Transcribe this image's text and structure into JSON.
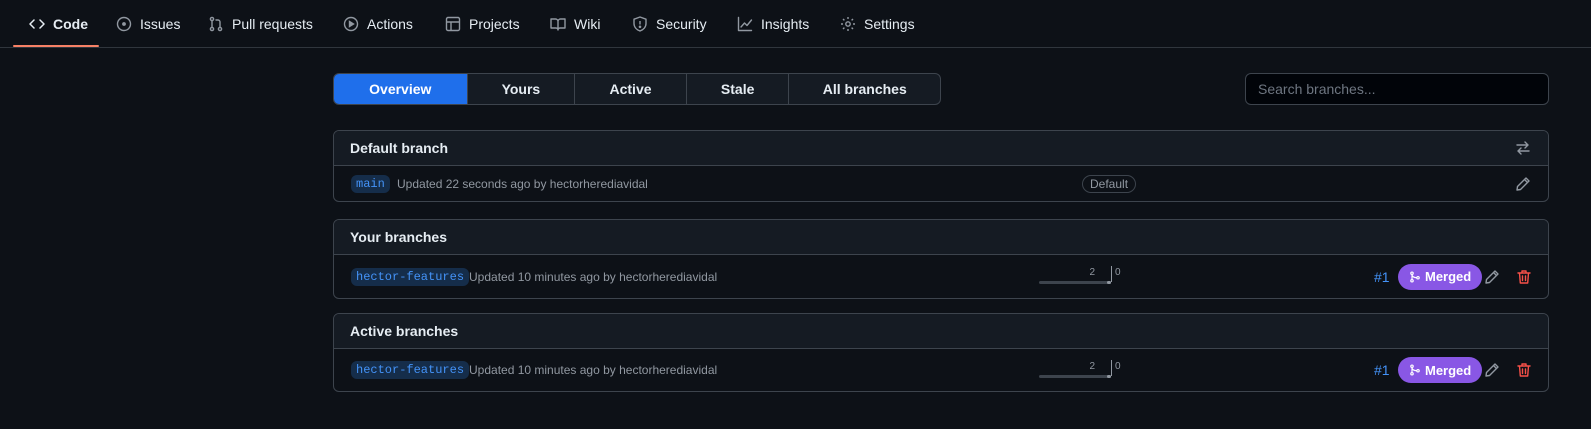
{
  "nav": {
    "items": [
      {
        "label": "Code",
        "icon": "code-icon"
      },
      {
        "label": "Issues",
        "icon": "issue-icon"
      },
      {
        "label": "Pull requests",
        "icon": "pull-request-icon"
      },
      {
        "label": "Actions",
        "icon": "play-icon"
      },
      {
        "label": "Projects",
        "icon": "table-icon"
      },
      {
        "label": "Wiki",
        "icon": "book-icon"
      },
      {
        "label": "Security",
        "icon": "shield-icon"
      },
      {
        "label": "Insights",
        "icon": "graph-icon"
      },
      {
        "label": "Settings",
        "icon": "gear-icon"
      }
    ],
    "selected": "Code"
  },
  "tabs": [
    "Overview",
    "Yours",
    "Active",
    "Stale",
    "All branches"
  ],
  "active_tab": "Overview",
  "search": {
    "placeholder": "Search branches..."
  },
  "default_branch": {
    "title": "Default branch",
    "branch": "main",
    "updated": "Updated 22 seconds ago by hectorherediavidal",
    "label": "Default"
  },
  "your_branches": {
    "title": "Your branches",
    "branch": "hector-features",
    "updated": "Updated 10 minutes ago by hectorherediavidal",
    "behind": "2",
    "ahead": "0",
    "pr": "#1",
    "status": "Merged"
  },
  "active_branches": {
    "title": "Active branches",
    "branch": "hector-features",
    "updated": "Updated 10 minutes ago by hectorherediavidal",
    "behind": "2",
    "ahead": "0",
    "pr": "#1",
    "status": "Merged"
  },
  "colors": {
    "accent": "#1f6feb",
    "merged": "#8957e5",
    "link": "#4493f8",
    "danger": "#f85149",
    "underline": "#f78166"
  }
}
